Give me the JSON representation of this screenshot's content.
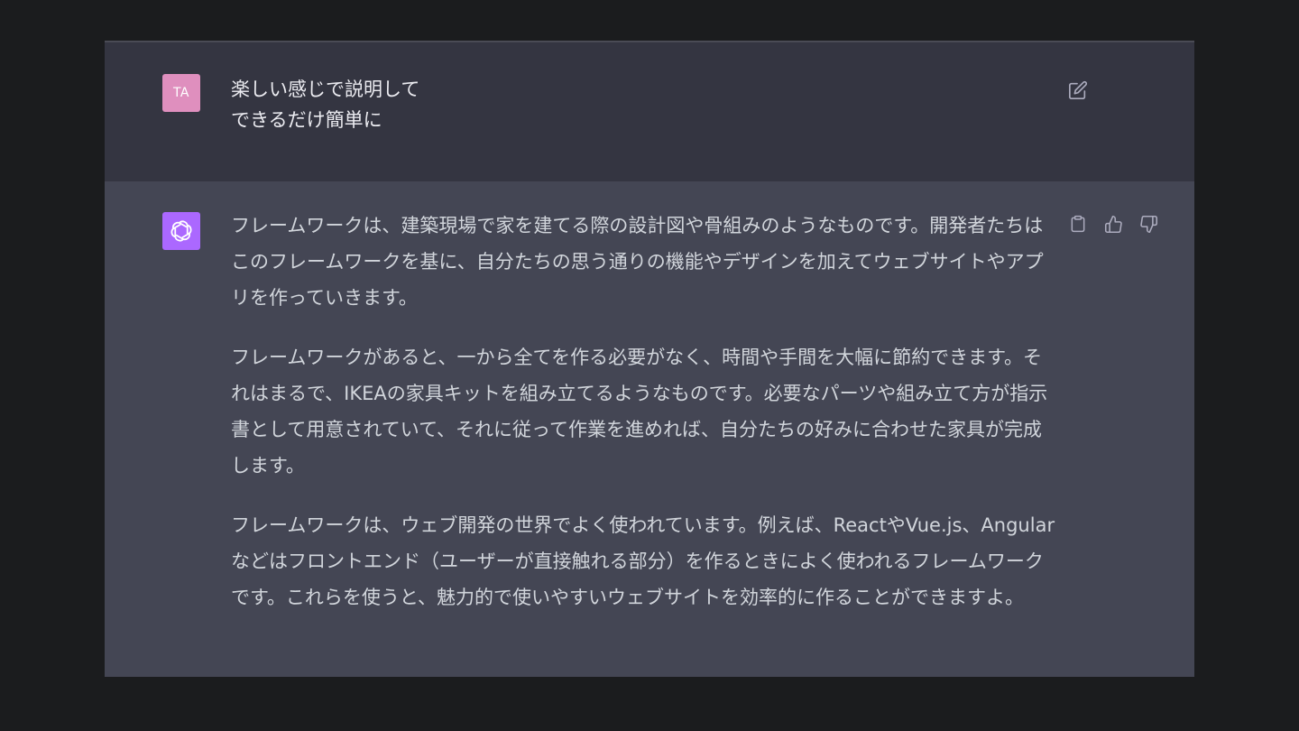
{
  "conversation": {
    "user": {
      "avatar_initials": "TA",
      "avatar_color": "#df8fbe",
      "lines": [
        "楽しい感じで説明して",
        "できるだけ簡単に"
      ],
      "edit_icon": "edit-icon"
    },
    "assistant": {
      "avatar_icon": "openai-logo-icon",
      "avatar_color": "#ab68ff",
      "paragraphs": [
        "フレームワークは、建築現場で家を建てる際の設計図や骨組みのようなものです。開発者たちはこのフレームワークを基に、自分たちの思う通りの機能やデザインを加えてウェブサイトやアプリを作っていきます。",
        "フレームワークがあると、一から全てを作る必要がなく、時間や手間を大幅に節約できます。それはまるで、IKEAの家具キットを組み立てるようなものです。必要なパーツや組み立て方が指示書として用意されていて、それに従って作業を進めれば、自分たちの好みに合わせた家具が完成します。",
        "フレームワークは、ウェブ開発の世界でよく使われています。例えば、ReactやVue.js、Angularなどはフロントエンド（ユーザーが直接触れる部分）を作るときによく使われるフレームワークです。これらを使うと、魅力的で使いやすいウェブサイトを効率的に作ることができますよ。"
      ],
      "action_icons": [
        "clipboard-icon",
        "thumbs-up-icon",
        "thumbs-down-icon"
      ]
    }
  },
  "colors": {
    "page_background": "#1b1c1e",
    "user_row_background": "#343541",
    "assistant_row_background": "#444654",
    "text": "#d1d5db"
  }
}
